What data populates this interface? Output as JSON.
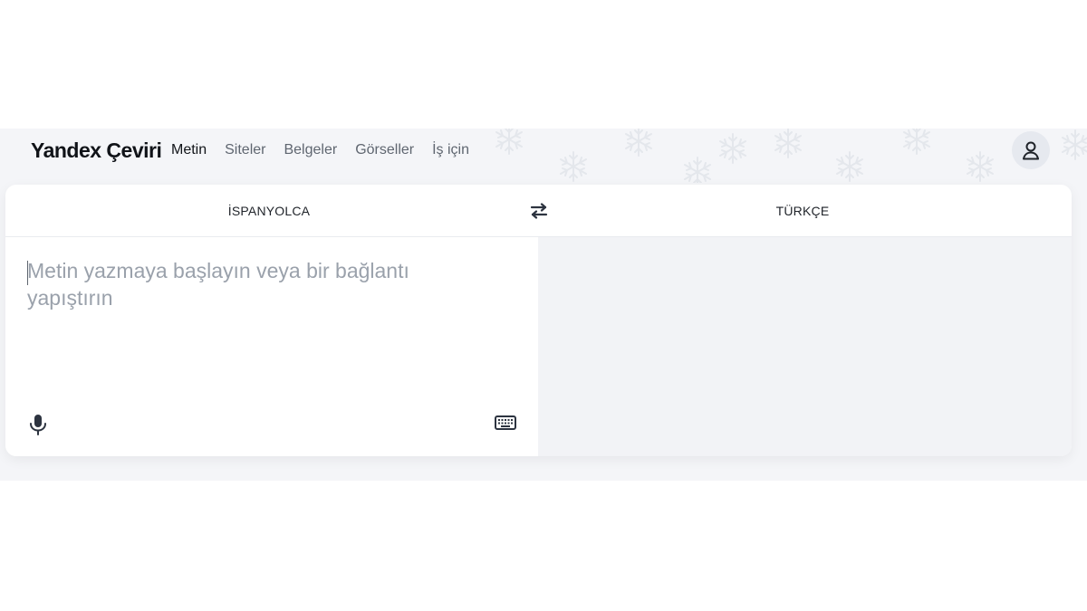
{
  "app": {
    "logo": "Yandex Çeviri"
  },
  "nav": {
    "items": [
      {
        "label": "Metin",
        "active": true
      },
      {
        "label": "Siteler",
        "active": false
      },
      {
        "label": "Belgeler",
        "active": false
      },
      {
        "label": "Görseller",
        "active": false
      },
      {
        "label": "İş için",
        "active": false
      }
    ]
  },
  "header": {
    "user_icon": "user-icon"
  },
  "translator": {
    "source_lang": "İSPANYOLCA",
    "target_lang": "TÜRKÇE",
    "swap_icon": "swap-arrows-icon",
    "input_placeholder": "Metin yazmaya başlayın veya bir bağlantı yapıştırın",
    "mic_icon": "microphone-icon",
    "keyboard_icon": "keyboard-icon"
  },
  "colors": {
    "page_background": "#ffffff",
    "app_background": "#f4f5f8",
    "target_panel": "#f2f3f6",
    "placeholder": "#9aa1ab"
  }
}
